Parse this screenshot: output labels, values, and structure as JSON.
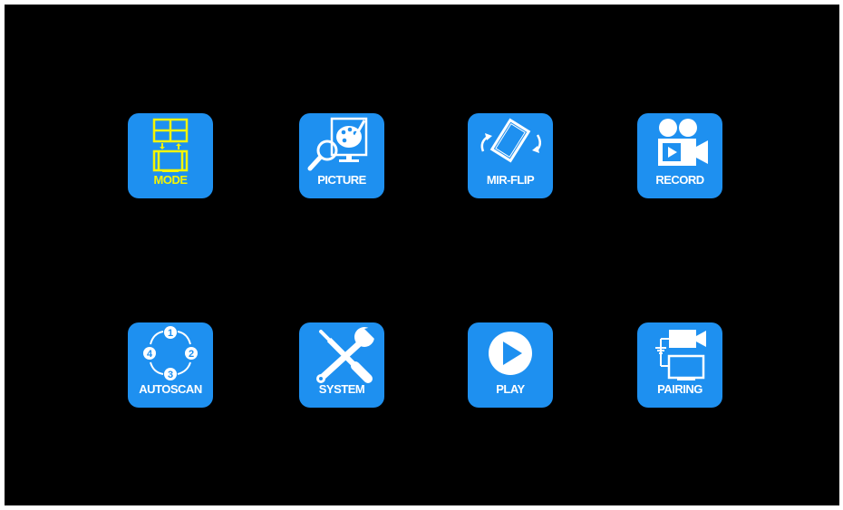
{
  "menu": {
    "items": [
      {
        "label": "MODE",
        "icon": "split-screen-mode-icon",
        "selected": true
      },
      {
        "label": "PICTURE",
        "icon": "picture-settings-icon",
        "selected": false
      },
      {
        "label": "MIR-FLIP",
        "icon": "mirror-flip-icon",
        "selected": false
      },
      {
        "label": "RECORD",
        "icon": "video-camera-record-icon",
        "selected": false
      },
      {
        "label": "AUTOSCAN",
        "icon": "autoscan-cycle-icon",
        "selected": false
      },
      {
        "label": "SYSTEM",
        "icon": "wrench-screwdriver-icon",
        "selected": false
      },
      {
        "label": "PLAY",
        "icon": "play-icon",
        "selected": false
      },
      {
        "label": "PAIRING",
        "icon": "camera-pairing-icon",
        "selected": false
      }
    ]
  },
  "colors": {
    "background": "#000000",
    "tile": "#1e90f0",
    "label": "#ffffff",
    "selected_highlight": "#f5f500"
  }
}
